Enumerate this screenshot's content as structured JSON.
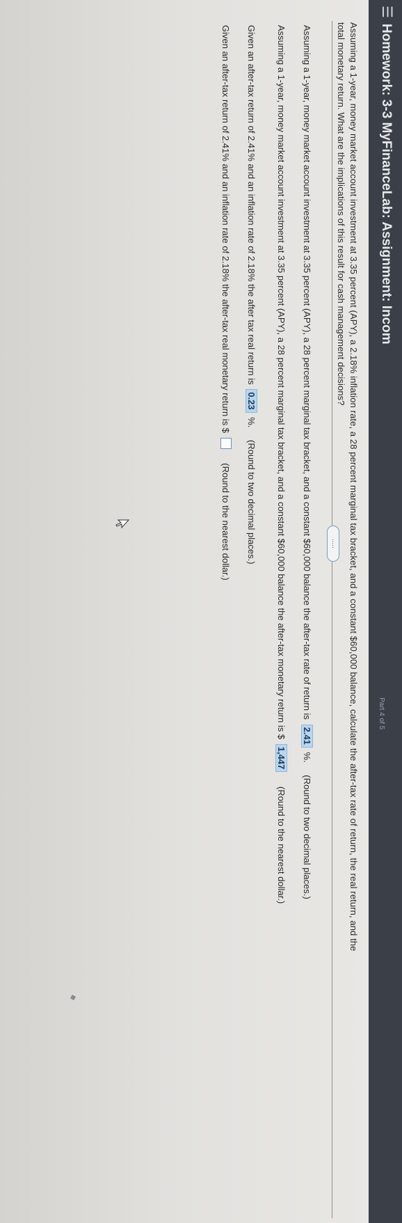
{
  "header": {
    "menu_icon": "hamburger-menu-icon",
    "title": "Homework: 3-3 MyFinanceLab: Assignment: Incom",
    "part": "Part 4 of 5"
  },
  "question": {
    "line1": "Assuming a 1-year, money market account investment at 3.35 percent (APY), a 2.18% inflation rate, a 28 percent marginal tax bracket, and a constant $60,000 balance, calculate the after-tax rate of return, the real return, and the",
    "line2": "total monetary return. What are the implications of this result for cash management decisions?",
    "more_button": "....."
  },
  "rows": [
    {
      "prefix": "Assuming a 1-year, money market account investment at 3.35 percent (APY), a 28 percent marginal tax bracket, and a constant $60,000 balance the after-tax rate of return is",
      "answer": "2.41",
      "suffix": "%.",
      "hint": "(Round to two decimal places.)"
    },
    {
      "prefix": "Assuming a 1-year, money market account investment at 3.35 percent (APY), a 28 percent marginal tax bracket, and a constant $60,000 balance the after-tax monetary return is $",
      "answer": "1,447",
      "suffix": "",
      "hint": "(Round to the nearest dollar.)"
    },
    {
      "prefix": "Given an after-tax return of 2.41% and an inflation rate of 2.18% the after tax real return is",
      "answer": "0.23",
      "suffix": "%.",
      "hint": "(Round to two decimal places.)"
    },
    {
      "prefix": "Given an after-tax return of 2.41% and an inflation rate of 2.18% the after-tax real monetary return is $",
      "answer": "",
      "suffix": "",
      "hint": "(Round to the nearest dollar.)"
    }
  ]
}
